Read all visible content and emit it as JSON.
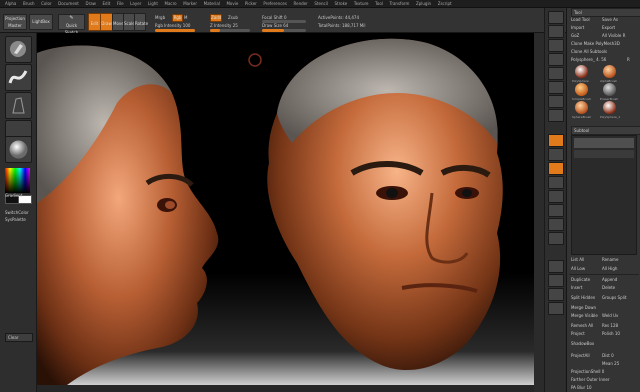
{
  "menu": [
    "Alpha",
    "Brush",
    "Color",
    "Document",
    "Draw",
    "Edit",
    "File",
    "Layer",
    "Light",
    "Macro",
    "Marker",
    "Material",
    "Movie",
    "Picker",
    "Preferences",
    "Render",
    "Stencil",
    "Stroke",
    "Texture",
    "Tool",
    "Transform",
    "Zplugin",
    "Zscript"
  ],
  "topbar": {
    "projection_master": "Projection Master",
    "lightbox": "LightBox",
    "quick_sketch": "Quick Sketch",
    "edit": "Edit",
    "draw": "Draw",
    "move": "Move",
    "scale": "Scale",
    "rotate": "Rotate",
    "mrgb": "Mrgb",
    "rgb": "Rgb",
    "m": "M",
    "zadd": "Zadd",
    "zsub": "Zsub",
    "rgb_intensity": "Rgb Intensity 100",
    "z_intensity": "Z Intensity 25",
    "focal_shift": "Focal Shift 0",
    "draw_size": "Draw Size 64",
    "active_points": "ActivePoints: 44,474",
    "total_points": "TotalPoints: 188,717 Mil",
    "rgb_intensity_level": 1.0,
    "z_intensity_level": 0.25,
    "draw_size_level": 0.5
  },
  "left": {
    "gradient": "Gradient",
    "switch_color": "SwitchColor",
    "alternate": "SysPalette",
    "clear": "Clear"
  },
  "tray": {
    "title": "Tool",
    "load_tool": "Load Tool",
    "save_as": "Save As",
    "import": "Import",
    "export": "Export",
    "goz": "GoZ",
    "all": "All",
    "visible": "Visible",
    "r": "R",
    "clone": "Clone",
    "make_polymesh": "Make PolyMesh3D",
    "clone_all_subtools": "Clone All Subtools",
    "current_tool": "Polysphere_ 4. 56",
    "r2": "R",
    "thumbs": [
      "PolySphere",
      "AlphaBrush",
      "SimpleBrush",
      "EraserBrush",
      "SphereBrush",
      "PolySphere_1"
    ],
    "subtool": "Subtool",
    "list_all": "List All",
    "rename": "Rename",
    "all_low": "All Low",
    "all_high": "All High",
    "duplicate": "Duplicate",
    "append": "Append",
    "insert": "Insert",
    "delete": "Delete",
    "split_hidden": "Split Hidden",
    "groups_split": "Groups Split",
    "merge_down": "Merge Down",
    "merge_visible": "Merge Visible",
    "weld": "Weld",
    "uv": "Uv",
    "remesh_all": "Remesh All",
    "res": "Res 128",
    "polish": "Polish 10",
    "project": "Project",
    "shadowbox": "ShadowBox",
    "project_all": "ProjectAll",
    "dist": "Dist 0",
    "mean": "Mean 25",
    "projection_shell": "ProjectionShell 0",
    "farther": "Farther",
    "outer": "Outer",
    "inner": "Inner",
    "pa_blur": "PA Blur 10"
  },
  "accent": "#e07a1a"
}
